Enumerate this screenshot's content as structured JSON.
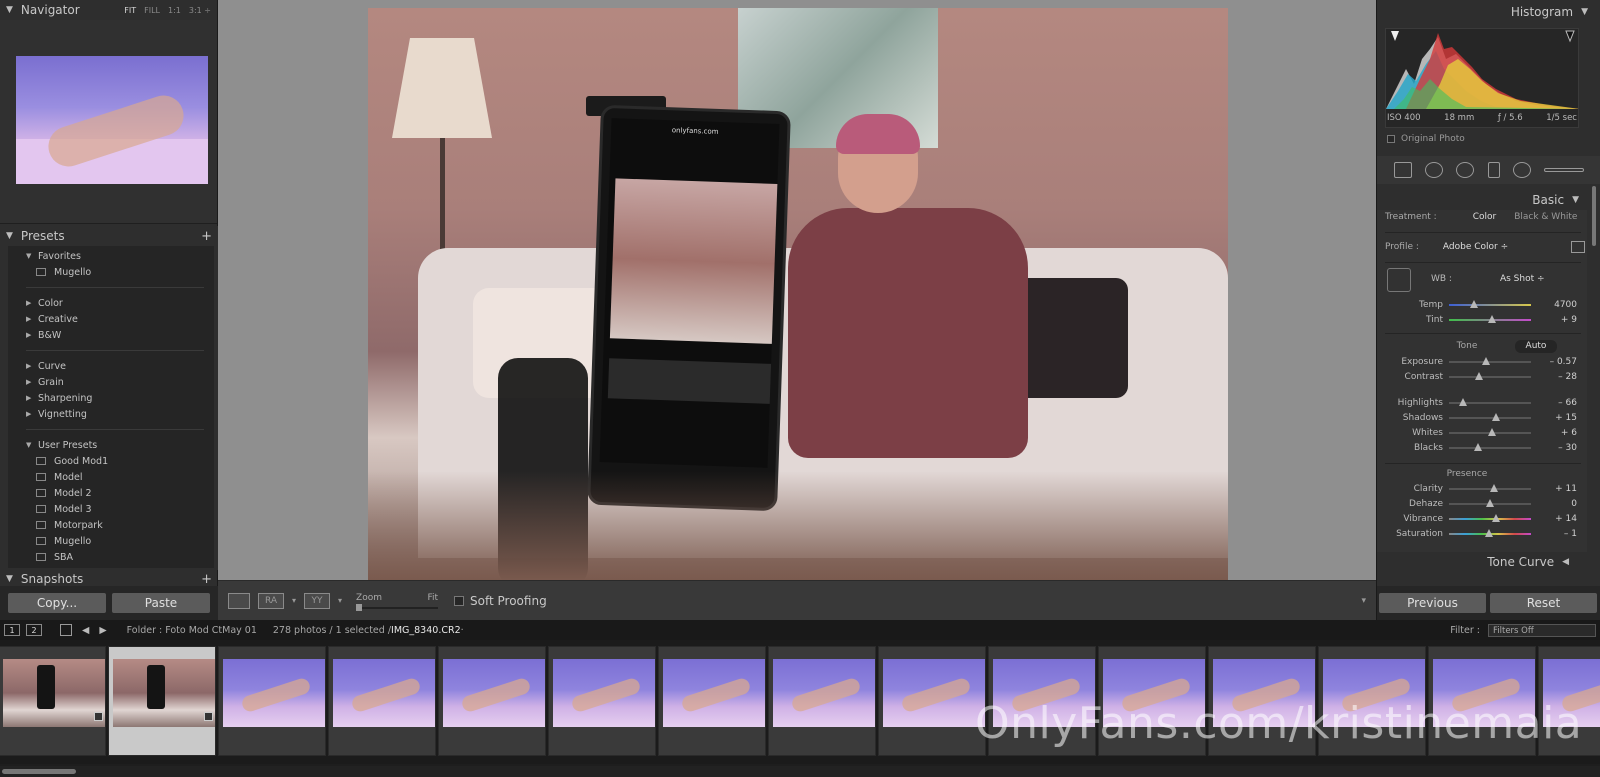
{
  "navigator": {
    "title": "Navigator",
    "options": [
      "FIT",
      "FILL",
      "1:1",
      "3:1 ÷"
    ]
  },
  "presets": {
    "title": "Presets",
    "favorites_label": "Favorites",
    "favorites": [
      "Mugello"
    ],
    "groups_a": [
      "Color",
      "Creative",
      "B&W"
    ],
    "groups_b": [
      "Curve",
      "Grain",
      "Sharpening",
      "Vignetting"
    ],
    "user_label": "User Presets",
    "user": [
      "Good Mod1",
      "Model",
      "Model 2",
      "Model 3",
      "Motorpark",
      "Mugello",
      "SBA"
    ]
  },
  "snapshots_title": "Snapshots",
  "left_buttons": {
    "copy": "Copy...",
    "paste": "Paste"
  },
  "toolbar": {
    "ry": "RA",
    "yy": "YY",
    "zoom_label": "Zoom",
    "zoom_value": "Fit",
    "soft_proofing": "Soft Proofing"
  },
  "photo": {
    "phone_url": "onlyfans.com"
  },
  "histogram": {
    "title": "Histogram",
    "iso": "ISO 400",
    "focal": "18 mm",
    "aperture": "ƒ / 5.6",
    "shutter": "1/5 sec",
    "original_photo": "Original Photo"
  },
  "basic": {
    "title": "Basic",
    "treatment_label": "Treatment :",
    "treatment_color": "Color",
    "treatment_bw": "Black & White",
    "profile_label": "Profile :",
    "profile_value": "Adobe Color ÷",
    "wb_label": "WB :",
    "wb_value": "As Shot ÷",
    "tone_label": "Tone",
    "auto_label": "Auto",
    "presence_label": "Presence",
    "sliders": [
      {
        "label": "Temp",
        "value": "4700",
        "pos": 0.3
      },
      {
        "label": "Tint",
        "value": "+ 9",
        "pos": 0.52
      },
      {
        "label": "Exposure",
        "value": "– 0.57",
        "pos": 0.45
      },
      {
        "label": "Contrast",
        "value": "– 28",
        "pos": 0.36
      },
      {
        "label": "Highlights",
        "value": "– 66",
        "pos": 0.17
      },
      {
        "label": "Shadows",
        "value": "+ 15",
        "pos": 0.57
      },
      {
        "label": "Whites",
        "value": "+ 6",
        "pos": 0.53
      },
      {
        "label": "Blacks",
        "value": "– 30",
        "pos": 0.35
      },
      {
        "label": "Clarity",
        "value": "+ 11",
        "pos": 0.55
      },
      {
        "label": "Dehaze",
        "value": "0",
        "pos": 0.5
      },
      {
        "label": "Vibrance",
        "value": "+ 14",
        "pos": 0.57
      },
      {
        "label": "Saturation",
        "value": "– 1",
        "pos": 0.49
      }
    ]
  },
  "tone_curve_title": "Tone Curve",
  "right_buttons": {
    "previous": "Previous",
    "reset": "Reset"
  },
  "filmstrip": {
    "screen1": "1",
    "screen2": "2",
    "folder": "Folder : Foto Mod CtMay 01",
    "count": "278 photos / 1 selected /",
    "filename": "IMG_8340.CR2",
    "filename_suffix": " ·",
    "filter_label": "Filter :",
    "filter_value": "Filters Off"
  },
  "watermark": "OnlyFans.com/kristinemaia",
  "colors": {
    "accent": "#c9c9c9",
    "panel": "#2e2e2e",
    "photo_bg": "#8f8f8f"
  }
}
